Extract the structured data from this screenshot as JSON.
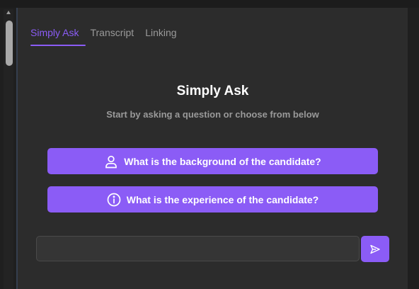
{
  "tabs": [
    {
      "label": "Simply Ask",
      "active": true
    },
    {
      "label": "Transcript",
      "active": false
    },
    {
      "label": "Linking",
      "active": false
    }
  ],
  "main": {
    "title": "Simply Ask",
    "subtitle": "Start by asking a question or choose from below",
    "suggestions": [
      {
        "label": "What is the background of the candidate?",
        "icon": "user-icon"
      },
      {
        "label": "What is the experience of the candidate?",
        "icon": "info-circle-icon"
      }
    ]
  },
  "composer": {
    "value": "",
    "placeholder": "",
    "send_icon": "send-icon"
  },
  "colors": {
    "accent": "#8b5cf6",
    "panel_bg": "#2c2c2c",
    "text_primary": "#ffffff",
    "text_muted": "#9a9a9a"
  }
}
